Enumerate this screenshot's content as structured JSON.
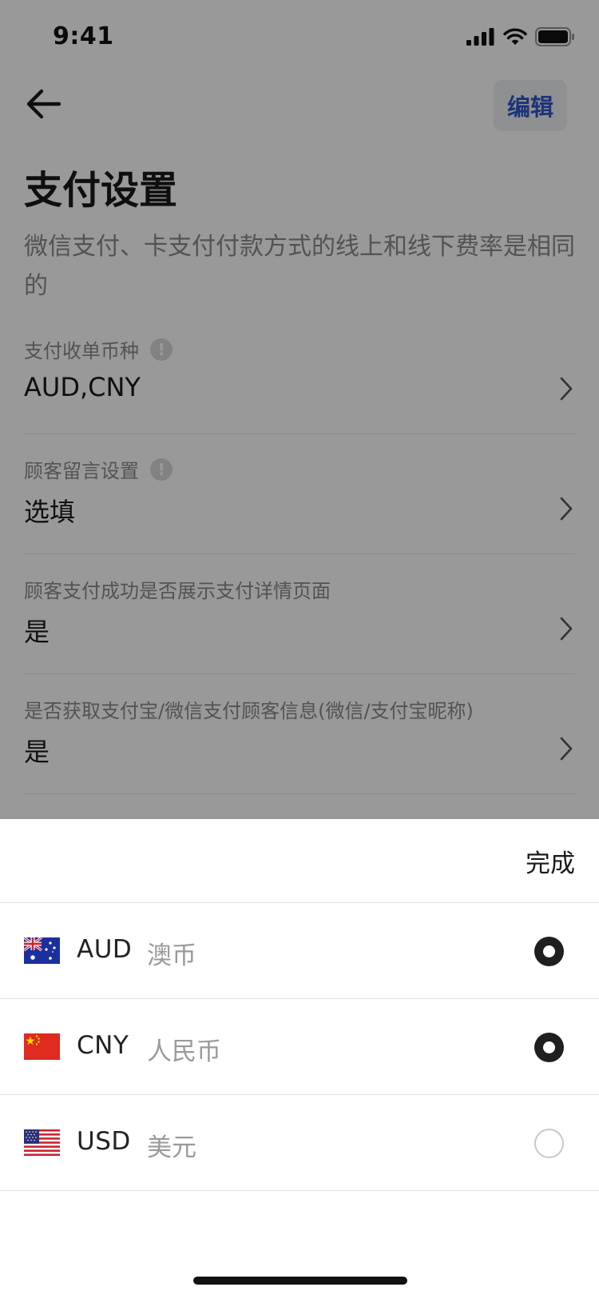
{
  "status_bar": {
    "time": "9:41"
  },
  "header": {
    "edit_label": "编辑"
  },
  "page": {
    "title": "支付设置",
    "description": "微信支付、卡支付付款方式的线上和线下费率是相同的"
  },
  "settings": [
    {
      "label": "支付收单币种",
      "value": "AUD,CNY",
      "has_info": true
    },
    {
      "label": "顾客留言设置",
      "value": "选填",
      "has_info": true
    },
    {
      "label": "顾客支付成功是否展示支付详情页面",
      "value": "是",
      "has_info": false
    },
    {
      "label": "是否获取支付宝/微信支付顾客信息(微信/支付宝昵称)",
      "value": "是",
      "has_info": false
    }
  ],
  "info_glyph": "!",
  "sheet": {
    "done_label": "完成",
    "currencies": [
      {
        "code": "AUD",
        "name": "澳币",
        "selected": true,
        "flag": "australia-flag"
      },
      {
        "code": "CNY",
        "name": "人民币",
        "selected": true,
        "flag": "china-flag"
      },
      {
        "code": "USD",
        "name": "美元",
        "selected": false,
        "flag": "usa-flag"
      }
    ]
  },
  "colors": {
    "accent": "#2e58c9",
    "overlay": "rgba(0,0,0,0.40)",
    "radio_on": "#1f1f1f"
  }
}
